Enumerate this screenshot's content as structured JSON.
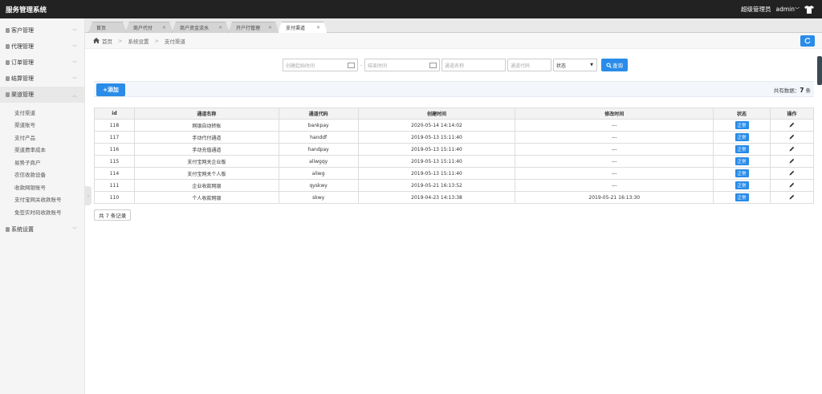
{
  "app": {
    "title": "服务管理系统",
    "user_role": "超级管理员",
    "user_name": "admin"
  },
  "sidebar": {
    "groups": [
      {
        "label": "客户管理"
      },
      {
        "label": "代理管理"
      },
      {
        "label": "订单管理"
      },
      {
        "label": "结算管理"
      },
      {
        "label": "渠道管理"
      },
      {
        "label": "系统设置"
      }
    ],
    "sub_items": [
      "支付渠道",
      "渠道账号",
      "支付产品",
      "渠道费率成本",
      "易势子商户",
      "农信收款设备",
      "收款网银账号",
      "支付宝网关收款账号",
      "免签实时码收款账号"
    ]
  },
  "tabs": [
    {
      "label": "首页"
    },
    {
      "label": "商户代付"
    },
    {
      "label": "商户资金流水"
    },
    {
      "label": "开户行管理"
    },
    {
      "label": "支付渠道"
    }
  ],
  "breadcrumb": {
    "home": "首页",
    "level1": "系统设置",
    "level2": "支付渠道"
  },
  "filters": {
    "start_time_placeholder": "创建起始时间",
    "end_time_placeholder": "结束时间",
    "channel_name_placeholder": "通道名称",
    "channel_code_placeholder": "通道代码",
    "status_selected": "状态",
    "search_label": "查询"
  },
  "toolbar": {
    "add_label": "添加",
    "total_label": "共有数据：",
    "total_count": "7",
    "total_unit": "条"
  },
  "table": {
    "headers": [
      "id",
      "通道名称",
      "通道代码",
      "创建时间",
      "修改时间",
      "状态",
      "操作"
    ],
    "rows": [
      {
        "id": "118",
        "name": "网银自动转账",
        "code": "bankpay",
        "created": "2020-05-14 14:14:02",
        "modified": "---",
        "status": "正常"
      },
      {
        "id": "117",
        "name": "手动代付通道",
        "code": "handdf",
        "created": "2019-05-13 15:11:40",
        "modified": "---",
        "status": "正常"
      },
      {
        "id": "116",
        "name": "手动充值通道",
        "code": "handpay",
        "created": "2019-05-13 15:11:40",
        "modified": "---",
        "status": "正常"
      },
      {
        "id": "115",
        "name": "支付宝网关企业版",
        "code": "aliwgqy",
        "created": "2019-05-13 15:11:40",
        "modified": "---",
        "status": "正常"
      },
      {
        "id": "114",
        "name": "支付宝网关个人版",
        "code": "aliwg",
        "created": "2019-05-13 15:11:40",
        "modified": "---",
        "status": "正常"
      },
      {
        "id": "111",
        "name": "企业收款网银",
        "code": "qyskwy",
        "created": "2019-05-21 16:13:52",
        "modified": "---",
        "status": "正常"
      },
      {
        "id": "110",
        "name": "个人收款网银",
        "code": "skwy",
        "created": "2019-04-23 14:13:38",
        "modified": "2019-05-21 16:13:30",
        "status": "正常"
      }
    ]
  },
  "footer": {
    "record_count": "共 7 条记录"
  },
  "colors": {
    "primary": "#2a8ce8",
    "topbar": "#222222"
  }
}
